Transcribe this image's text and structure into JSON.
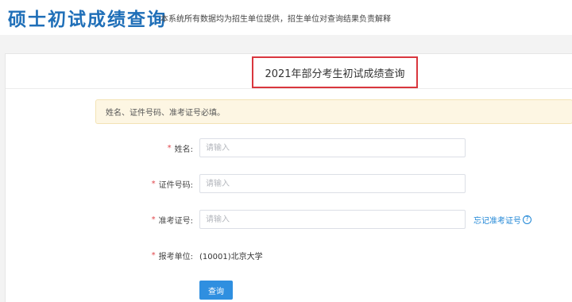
{
  "header": {
    "title": "硕士初试成绩查询",
    "subtitle": "本系统所有数据均为招生单位提供，招生单位对查询结果负责解释"
  },
  "panel": {
    "title": "2021年部分考生初试成绩查询"
  },
  "alert": {
    "text": "姓名、证件号码、准考证号必填。"
  },
  "form": {
    "required_mark": "*",
    "name": {
      "label": "姓名:",
      "placeholder": "请输入",
      "value": ""
    },
    "id_number": {
      "label": "证件号码:",
      "placeholder": "请输入",
      "value": ""
    },
    "exam_number": {
      "label": "准考证号:",
      "placeholder": "请输入",
      "value": "",
      "forgot_link": "忘记准考证号",
      "help_icon": "?"
    },
    "school": {
      "label": "报考单位:",
      "value": "(10001)北京大学"
    },
    "submit_label": "查询"
  },
  "colors": {
    "title_blue": "#1f6fb8",
    "highlight_red": "#d9363e",
    "required_red": "#e0454a",
    "link_blue": "#1f86d6",
    "button_blue": "#2f8fe0",
    "alert_bg": "#fdf6e3"
  },
  "icons": {
    "help": "question-circle-icon"
  }
}
